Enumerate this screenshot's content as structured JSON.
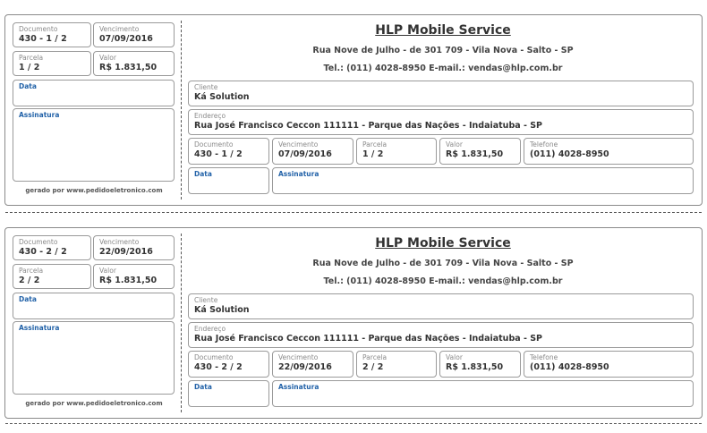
{
  "company": {
    "name": "HLP Mobile Service",
    "address": "Rua Nove de Julho - de 301 709 - Vila Nova - Salto - SP",
    "contact": "Tel.: (011) 4028-8950 E-mail.: vendas@hlp.com.br"
  },
  "labels": {
    "documento": "Documento",
    "vencimento": "Vencimento",
    "parcela": "Parcela",
    "valor": "Valor",
    "data": "Data",
    "assinatura": "Assinatura",
    "cliente": "Cliente",
    "endereco": "Endereço",
    "telefone": "Telefone"
  },
  "footer_note": "gerado por www.pedidoeletronico.com",
  "customer": {
    "name": "Ká Solution",
    "address": "Rua José Francisco Ceccon 111111 - Parque das Nações - Indaiatuba - SP",
    "phone": "(011) 4028-8950"
  },
  "slips": [
    {
      "documento": "430 - 1 / 2",
      "vencimento": "07/09/2016",
      "parcela": "1 / 2",
      "valor": "R$ 1.831,50"
    },
    {
      "documento": "430 - 2 / 2",
      "vencimento": "22/09/2016",
      "parcela": "2 / 2",
      "valor": "R$ 1.831,50"
    }
  ]
}
